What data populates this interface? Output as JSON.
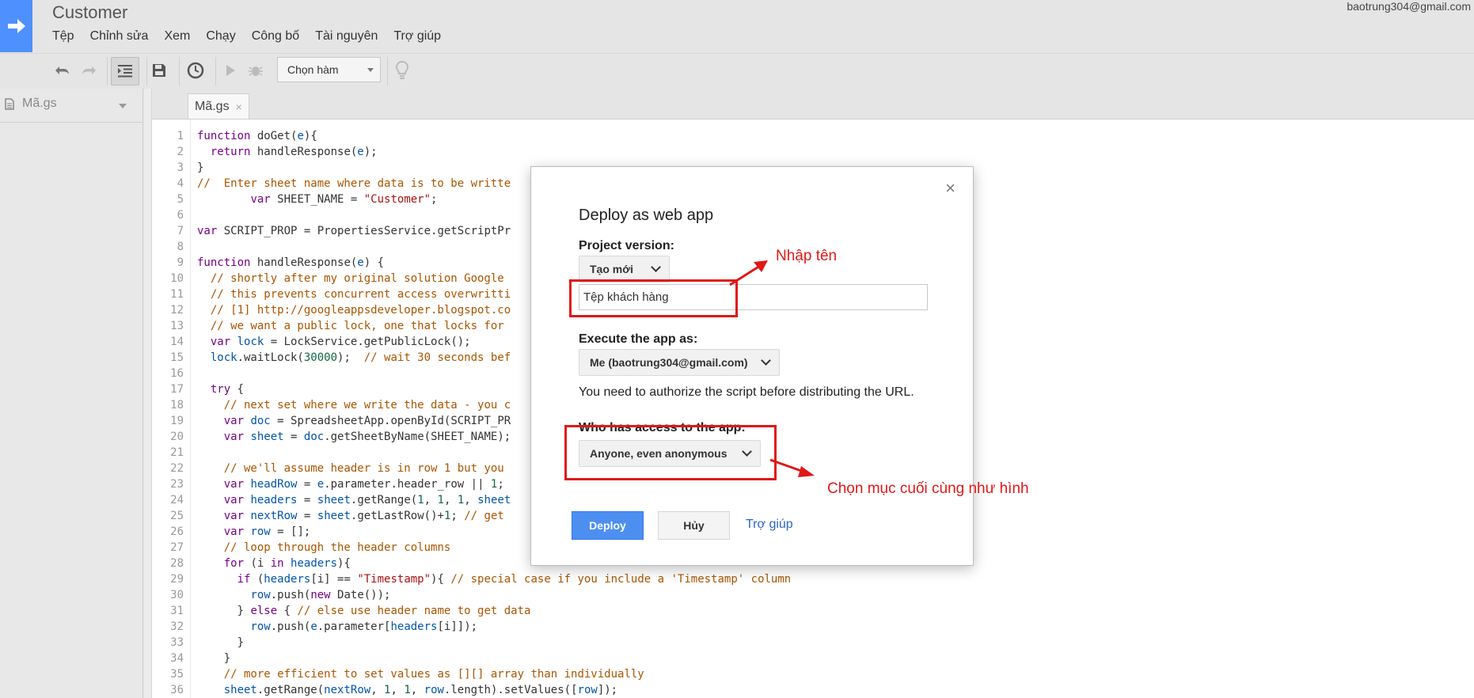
{
  "app": {
    "title": "Customer",
    "account": "baotrung304@gmail.com"
  },
  "menu": [
    "Tệp",
    "Chỉnh sửa",
    "Xem",
    "Chạy",
    "Công bố",
    "Tài nguyên",
    "Trợ giúp"
  ],
  "toolbar": {
    "function_select": "Chọn hàm"
  },
  "sidebar": {
    "file": "Mã.gs"
  },
  "tab": {
    "label": "Mã.gs",
    "close": "×"
  },
  "code_lines": [
    "function doGet(e){",
    "  return handleResponse(e);",
    "}",
    "//  Enter sheet name where data is to be writte",
    "        var SHEET_NAME = \"Customer\";",
    "",
    "var SCRIPT_PROP = PropertiesService.getScriptPr",
    "",
    "function handleResponse(e) {",
    "  // shortly after my original solution Google ",
    "  // this prevents concurrent access overwritti",
    "  // [1] http://googleappsdeveloper.blogspot.co",
    "  // we want a public lock, one that locks for ",
    "  var lock = LockService.getPublicLock();",
    "  lock.waitLock(30000);  // wait 30 seconds bef",
    "",
    "  try {",
    "    // next set where we write the data - you c",
    "    var doc = SpreadsheetApp.openById(SCRIPT_PR",
    "    var sheet = doc.getSheetByName(SHEET_NAME);",
    "",
    "    // we'll assume header is in row 1 but you ",
    "    var headRow = e.parameter.header_row || 1; ",
    "    var headers = sheet.getRange(1, 1, 1, sheet",
    "    var nextRow = sheet.getLastRow()+1; // get ",
    "    var row = [];",
    "    // loop through the header columns",
    "    for (i in headers){",
    "      if (headers[i] == \"Timestamp\"){ // special case if you include a 'Timestamp' column",
    "        row.push(new Date());",
    "      } else { // else use header name to get data",
    "        row.push(e.parameter[headers[i]]);",
    "      }",
    "    }",
    "    // more efficient to set values as [][] array than individually",
    "    sheet.getRange(nextRow, 1, 1, row.length).setValues([row]);"
  ],
  "dialog": {
    "close": "×",
    "title": "Deploy as web app",
    "project_version_label": "Project version:",
    "project_version_value": "Tạo mới",
    "description_value": "Tệp khách hàng",
    "execute_label": "Execute the app as:",
    "execute_value": "Me (baotrung304@gmail.com)",
    "authorize_note": "You need to authorize the script before distributing the URL.",
    "access_label": "Who has access to the app:",
    "access_value": "Anyone, even anonymous",
    "deploy_button": "Deploy",
    "cancel_button": "Hủy",
    "help_link": "Trợ giúp"
  },
  "annotations": {
    "enter_name": "Nhập tên",
    "choose_last": "Chọn mục cuối cùng như hình",
    "color": "#e01818"
  },
  "colors": {
    "accent": "#4d90fe",
    "deploy": "#4d8ff0",
    "link": "#2a66c7"
  }
}
